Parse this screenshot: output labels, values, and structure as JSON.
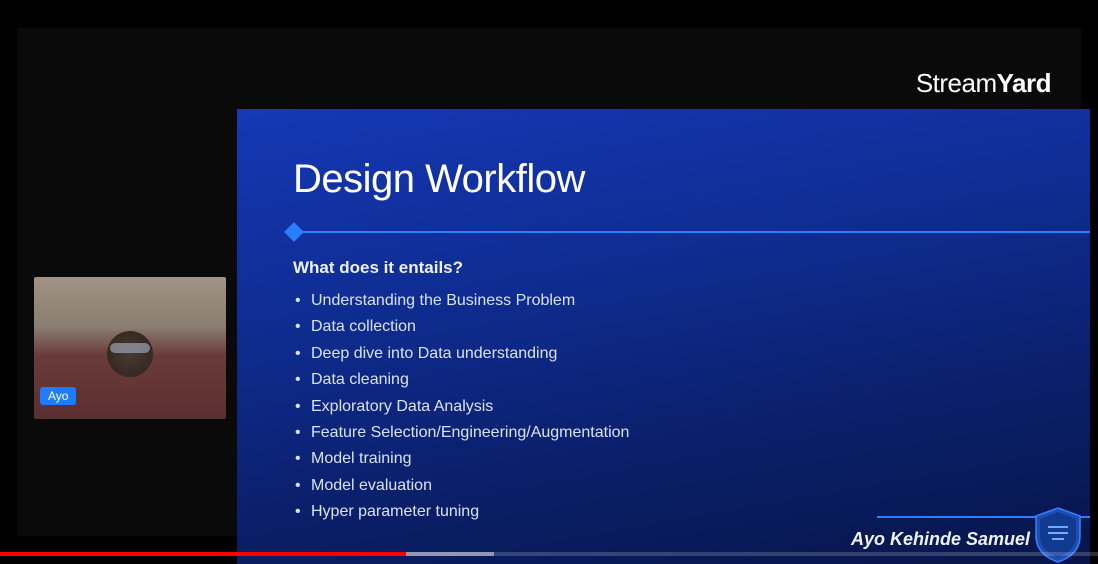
{
  "watermark": {
    "light": "Stream",
    "bold": "Yard"
  },
  "webcam": {
    "name_tag": "Ayo"
  },
  "slide": {
    "title": "Design Workflow",
    "subheading": "What does it entails?",
    "bullets": [
      "Understanding the Business Problem",
      "Data collection",
      "Deep dive into Data understanding",
      "Data cleaning",
      "Exploratory Data Analysis",
      "Feature Selection/Engineering/Augmentation",
      "Model training",
      "Model evaluation",
      "Hyper parameter tuning"
    ],
    "presenter": "Ayo Kehinde Samuel"
  },
  "player": {
    "played_pct": 37,
    "buffer_pct": 45
  }
}
